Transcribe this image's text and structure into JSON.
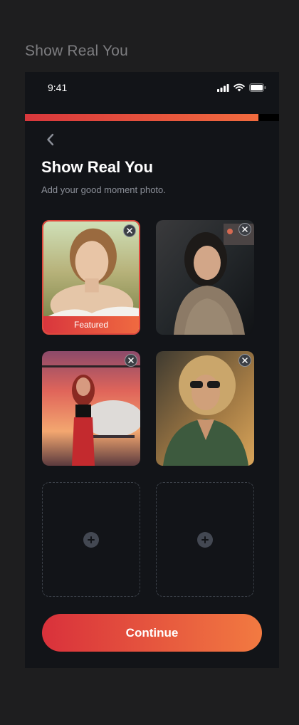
{
  "board": {
    "title": "Show Real You"
  },
  "status_bar": {
    "time": "9:41"
  },
  "onboarding": {
    "progress": 0.92
  },
  "screen": {
    "title": "Show Real You",
    "subtitle": "Add your good moment photo."
  },
  "photos": [
    {
      "description": "woman in white off-shoulder dress in a field",
      "featured": true,
      "badge": "Featured"
    },
    {
      "description": "woman in sequined dress inside a car"
    },
    {
      "description": "woman in red outfit in front of a helicopter at sunset"
    },
    {
      "description": "woman with sunglasses and green jacket at golden hour"
    }
  ],
  "empty_slots": 2,
  "actions": {
    "continue_label": "Continue"
  },
  "colors": {
    "accent_start": "#d9313b",
    "accent_end": "#f27a41",
    "background": "#121418"
  },
  "icons": [
    "back-chevron-icon",
    "signal-icon",
    "wifi-icon",
    "battery-icon",
    "close-icon",
    "plus-icon"
  ]
}
